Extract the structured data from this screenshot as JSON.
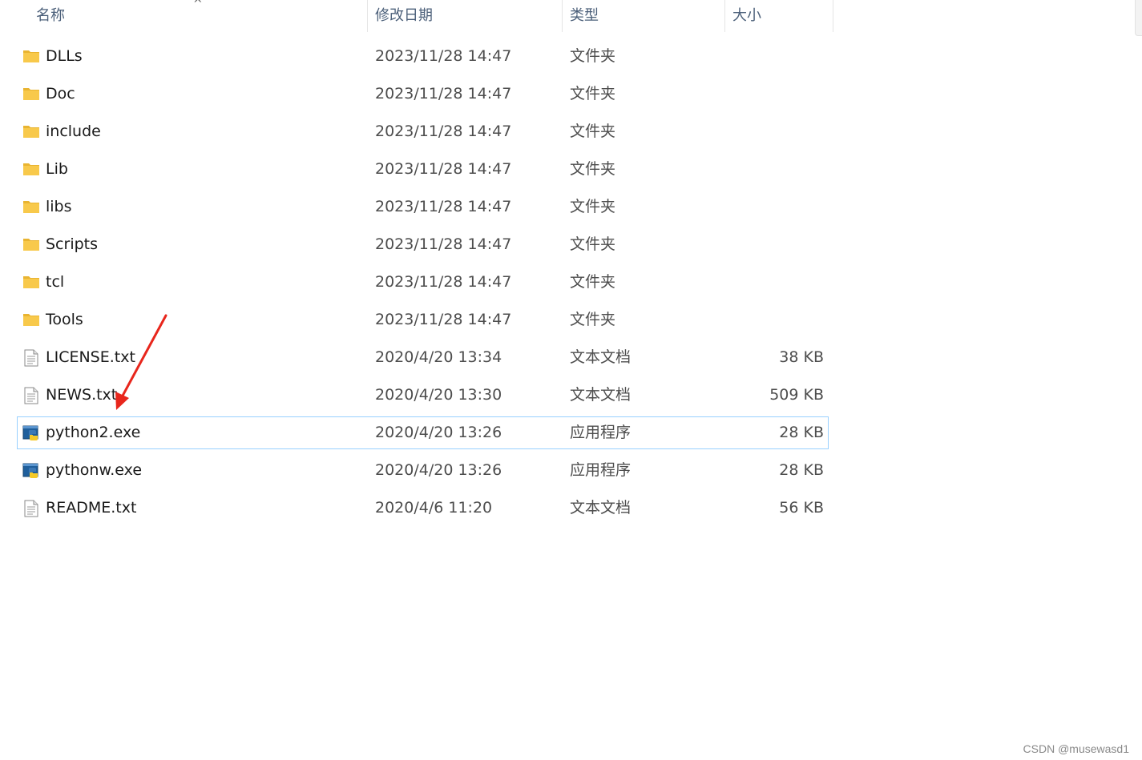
{
  "columns": {
    "name": "名称",
    "date": "修改日期",
    "type": "类型",
    "size": "大小"
  },
  "files": [
    {
      "name": "DLLs",
      "date": "2023/11/28 14:47",
      "type": "文件夹",
      "size": "",
      "icon": "folder-icon"
    },
    {
      "name": "Doc",
      "date": "2023/11/28 14:47",
      "type": "文件夹",
      "size": "",
      "icon": "folder-icon"
    },
    {
      "name": "include",
      "date": "2023/11/28 14:47",
      "type": "文件夹",
      "size": "",
      "icon": "folder-icon"
    },
    {
      "name": "Lib",
      "date": "2023/11/28 14:47",
      "type": "文件夹",
      "size": "",
      "icon": "folder-icon"
    },
    {
      "name": "libs",
      "date": "2023/11/28 14:47",
      "type": "文件夹",
      "size": "",
      "icon": "folder-icon"
    },
    {
      "name": "Scripts",
      "date": "2023/11/28 14:47",
      "type": "文件夹",
      "size": "",
      "icon": "folder-icon"
    },
    {
      "name": "tcl",
      "date": "2023/11/28 14:47",
      "type": "文件夹",
      "size": "",
      "icon": "folder-icon"
    },
    {
      "name": "Tools",
      "date": "2023/11/28 14:47",
      "type": "文件夹",
      "size": "",
      "icon": "folder-icon"
    },
    {
      "name": "LICENSE.txt",
      "date": "2020/4/20 13:34",
      "type": "文本文档",
      "size": "38 KB",
      "icon": "text-file-icon"
    },
    {
      "name": "NEWS.txt",
      "date": "2020/4/20 13:30",
      "type": "文本文档",
      "size": "509 KB",
      "icon": "text-file-icon"
    },
    {
      "name": "python2.exe",
      "date": "2020/4/20 13:26",
      "type": "应用程序",
      "size": "28 KB",
      "icon": "python-exe-icon",
      "selected": true
    },
    {
      "name": "pythonw.exe",
      "date": "2020/4/20 13:26",
      "type": "应用程序",
      "size": "28 KB",
      "icon": "python-exe-icon"
    },
    {
      "name": "README.txt",
      "date": "2020/4/6 11:20",
      "type": "文本文档",
      "size": "56 KB",
      "icon": "text-file-icon"
    }
  ],
  "watermark": "CSDN @musewasd1",
  "colors": {
    "selection_border": "#99d1ff",
    "folder": "#f8c94b",
    "arrow": "#e8261c"
  }
}
